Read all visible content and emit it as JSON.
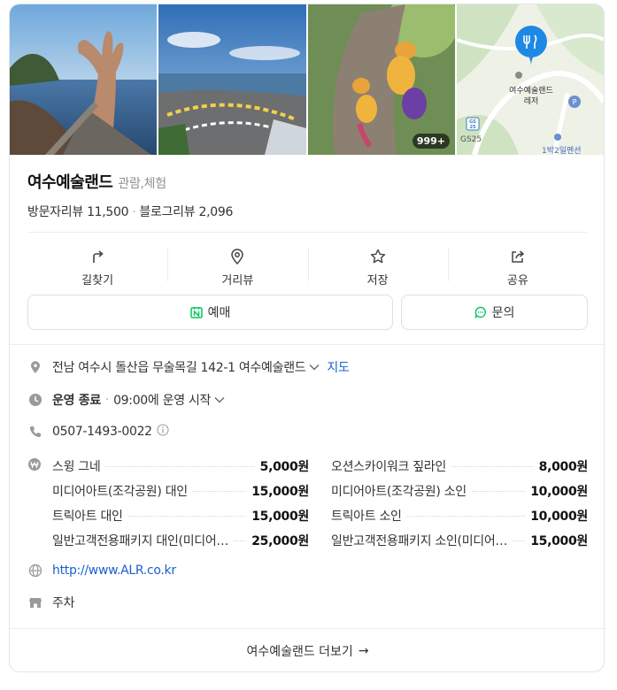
{
  "place": {
    "name": "여수예술랜드",
    "category": "관람,체험"
  },
  "photos": {
    "more_count": "999+",
    "map_label_line1": "여수예술랜드",
    "map_label_line2": "레저",
    "map_gs_badge": "GS 25",
    "map_gs_label": "GS25",
    "map_poi_label": "1박2일펜션",
    "map_parking": "P"
  },
  "reviews": {
    "visitor_label": "방문자리뷰",
    "visitor_count": "11,500",
    "blog_label": "블로그리뷰",
    "blog_count": "2,096"
  },
  "actions": [
    {
      "label": "길찾기",
      "icon": "directions-icon"
    },
    {
      "label": "거리뷰",
      "icon": "streetview-pin-icon"
    },
    {
      "label": "저장",
      "icon": "star-icon"
    },
    {
      "label": "공유",
      "icon": "share-icon"
    }
  ],
  "buttons": {
    "reserve": "예매",
    "inquiry": "문의"
  },
  "address": {
    "text": "전남 여수시 돌산읍 무술목길 142-1 여수예술랜드",
    "map_link": "지도"
  },
  "hours": {
    "status": "운영 종료",
    "next": "09:00에 운영 시작"
  },
  "phone": "0507-1493-0022",
  "prices": [
    {
      "name": "스윙 그네",
      "value": "5,000원"
    },
    {
      "name": "오션스카이워크 짚라인",
      "value": "8,000원"
    },
    {
      "name": "미디어아트(조각공원) 대인",
      "value": "15,000원"
    },
    {
      "name": "미디어아트(조각공원) 소인",
      "value": "10,000원"
    },
    {
      "name": "트릭아트 대인",
      "value": "15,000원"
    },
    {
      "name": "트릭아트 소인",
      "value": "10,000원"
    },
    {
      "name": "일반고객전용패키지 대인(미디어…",
      "value": "25,000원"
    },
    {
      "name": "일반고객전용패키지 소인(미디어…",
      "value": "15,000원"
    }
  ],
  "website": "http://www.ALR.co.kr",
  "parking": "주차",
  "footer": {
    "label": "여수예술랜드 더보기",
    "arrow": "→"
  },
  "colors": {
    "accent_blue": "#1a5fd1",
    "naver_green": "#03c75a",
    "map_pin": "#1e88e5",
    "icon_gray": "#9a9a9a"
  }
}
